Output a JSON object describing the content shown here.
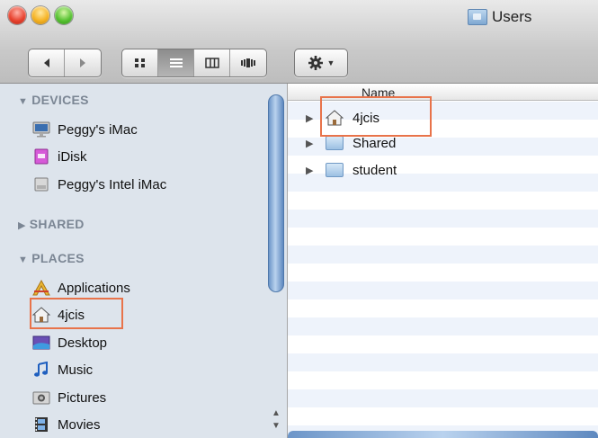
{
  "window": {
    "title": "Users"
  },
  "toolbar": {
    "back_icon": "back-arrow-icon",
    "forward_icon": "forward-arrow-icon",
    "view_icons": [
      "icon-view-icon",
      "list-view-icon",
      "column-view-icon",
      "coverflow-view-icon"
    ],
    "action_icon": "gear-icon"
  },
  "sidebar": {
    "sections": [
      {
        "label": "DEVICES",
        "expanded": true
      },
      {
        "label": "SHARED",
        "expanded": false
      },
      {
        "label": "PLACES",
        "expanded": true
      }
    ],
    "devices": [
      {
        "label": "Peggy's iMac",
        "icon": "imac-icon"
      },
      {
        "label": "iDisk",
        "icon": "idisk-icon"
      },
      {
        "label": "Peggy's Intel iMac",
        "icon": "drive-icon"
      }
    ],
    "places": [
      {
        "label": "Applications",
        "icon": "applications-icon"
      },
      {
        "label": "4jcis",
        "icon": "home-icon"
      },
      {
        "label": "Desktop",
        "icon": "desktop-icon"
      },
      {
        "label": "Music",
        "icon": "music-icon"
      },
      {
        "label": "Pictures",
        "icon": "pictures-icon"
      },
      {
        "label": "Movies",
        "icon": "movies-icon"
      }
    ]
  },
  "list": {
    "column_header": "Name",
    "rows": [
      {
        "label": "4jcis",
        "icon": "home-icon"
      },
      {
        "label": "Shared",
        "icon": "folder-icon"
      },
      {
        "label": "student",
        "icon": "folder-icon"
      }
    ]
  },
  "colors": {
    "sidebar_bg": "#dde4ec",
    "highlight": "#e8734a",
    "stripe": "#eef3fb"
  }
}
